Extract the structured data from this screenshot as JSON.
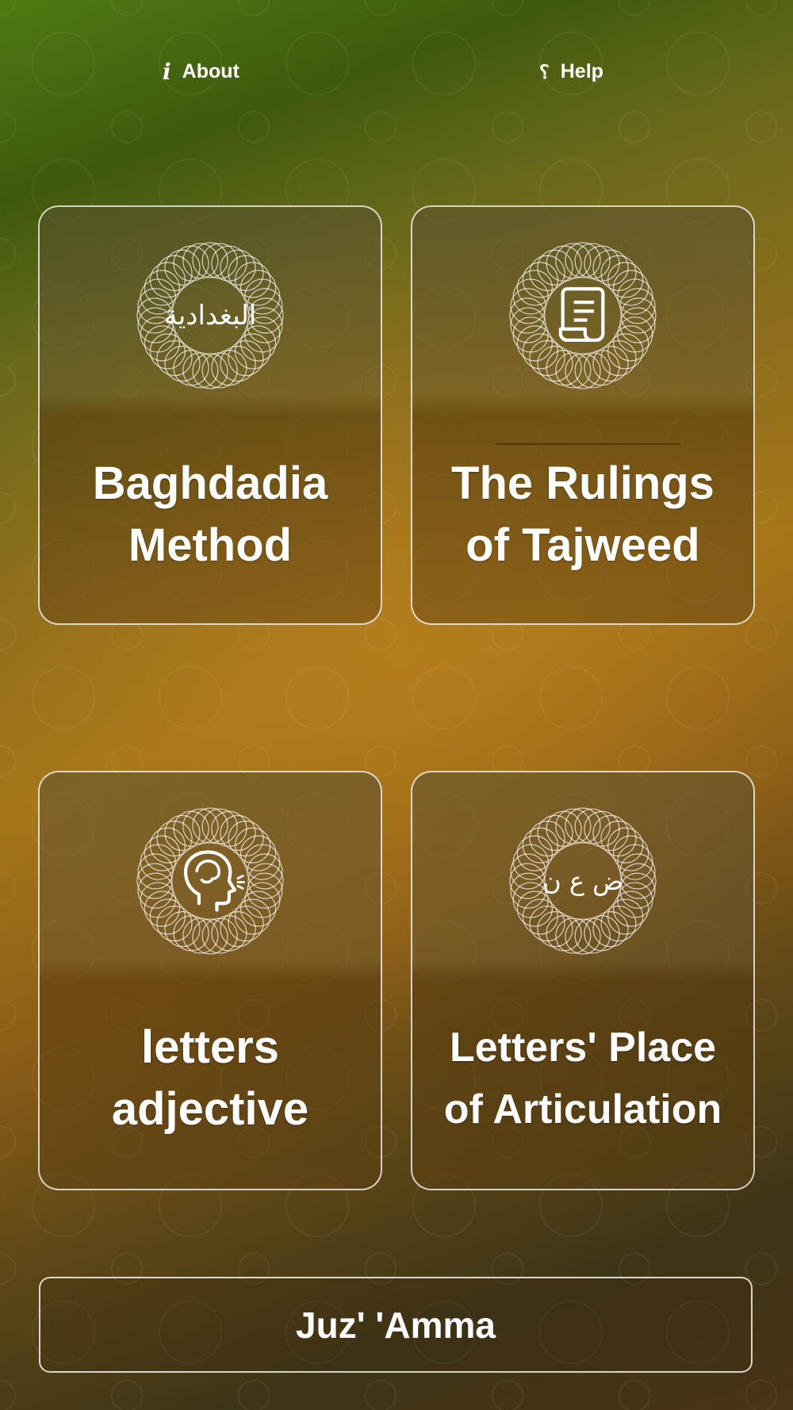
{
  "topbar": {
    "about_label": "About",
    "help_label": "Help"
  },
  "cards": [
    {
      "title_line1": "Baghdadia",
      "title_line2": "Method",
      "icon": "baghdadia-calligraphy-icon",
      "calligraphy": "البغدادية"
    },
    {
      "title_line1": "The Rulings",
      "title_line2": "of Tajweed",
      "icon": "scroll-document-icon"
    },
    {
      "title_line1": "letters",
      "title_line2": "adjective",
      "icon": "head-speaking-icon"
    },
    {
      "title_line1": "Letters' Place",
      "title_line2": "of Articulation",
      "icon": "arabic-letters-icon",
      "letters": "ض ع ن"
    }
  ],
  "juz_button": {
    "label": "Juz' 'Amma"
  },
  "colors": {
    "accent_green": "#4f7a12",
    "accent_amber": "#a57619",
    "border": "#ffffff"
  }
}
